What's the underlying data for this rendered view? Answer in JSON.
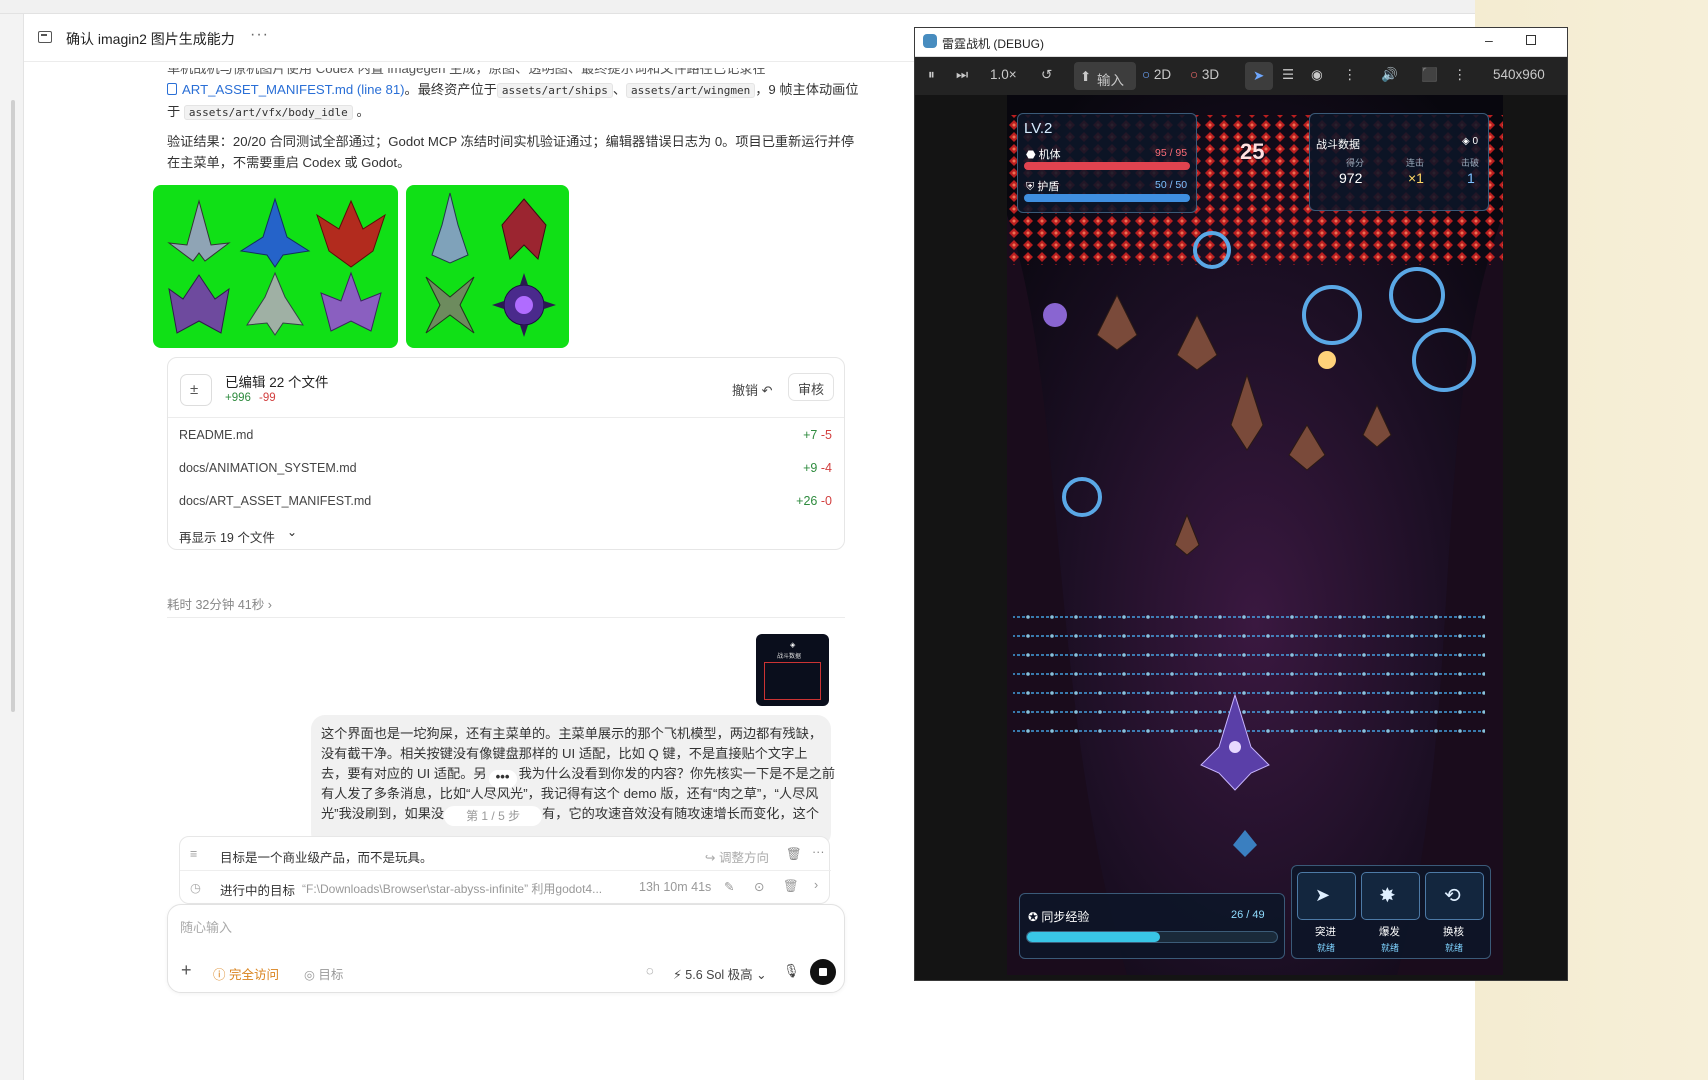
{
  "codex": {
    "chat_title": "确认 imagin2 图片生成能力",
    "more_label": "···",
    "para1_cut": "单机战机与僚机图片使用 Codex 内置 imagegen 生成，原图、透明图、最终提示词和文件路径已记录在",
    "manifest_link": "ART_ASSET_MANIFEST.md (line 81)",
    "para1_mid": "。最终资产位于",
    "path_ships": "assets/art/ships",
    "sep": "、",
    "path_wingmen": "assets/art/wingmen",
    "para1_end": "，9 帧主体动画位",
    "para1_pre": "于",
    "path_vfx": "assets/art/vfx/body_idle",
    "para1_dot": "。",
    "verify_line1": "验证结果：20/20 合同测试全部通过；Godot MCP 冻结时间实机验证通过；编辑器错误日志为 0。项目已重新运行并停",
    "verify_line2": "在主菜单，不需要重启 Codex 或 Godot。",
    "files_card": {
      "title": "已编辑 22 个文件",
      "added": "+996",
      "removed": "-99",
      "undo": "撤销",
      "review": "审核",
      "files": [
        {
          "name": "README.md",
          "added": "+7",
          "removed": "-5"
        },
        {
          "name": "docs/ANIMATION_SYSTEM.md",
          "added": "+9",
          "removed": "-4"
        },
        {
          "name": "docs/ART_ASSET_MANIFEST.md",
          "added": "+26",
          "removed": "-0"
        }
      ],
      "show_more": "再显示 19 个文件"
    },
    "elapsed": "耗时 32分钟 41秒",
    "bubble_lines": [
      "这个界面也是一坨狗屎，还有主菜单的。主菜单展示的那个飞机模型，两边都有残缺，",
      "没有截干净。相关按键没有像键盘那样的 UI 适配，比如 Q 键，不是直接贴个文字上",
      "去，要有对应的 UI 适配。另",
      "我为什么没看到你发的内容？你先核实一下是不是之前",
      "有人发了多条消息，比如“人尽风光”，我记得有这个 demo 版，还有“肉之草”，“人尽风",
      "光”我没刷到，如果没",
      "有，它的攻速音效没有随攻速增长而变化，这个"
    ],
    "step_badge": "第 1 / 5 步",
    "goal_text": "目标是一个商业级产品，而不是玩具。",
    "goal_adjust": "调整方向",
    "progress_label": "进行中的目标",
    "progress_path": "“F:\\Downloads\\Browser\\star-abyss-infinite” 利用godot4...",
    "progress_time": "13h 10m 41s",
    "input_placeholder": "随心输入",
    "full_access": "完全访问",
    "goal_btn": "目标",
    "model": "5.6 Sol 极高"
  },
  "game": {
    "window_title": "雷霆战机 (DEBUG)",
    "speed": "1.0×",
    "input_label": "输入",
    "mode_2d": "2D",
    "mode_3d": "3D",
    "resolution": "540x960",
    "level": "LV.2",
    "hull_label": "机体",
    "hull_value": "95 / 95",
    "hull_fraction": 1.0,
    "shield_label": "护盾",
    "shield_value": "50 / 50",
    "shield_fraction": 1.0,
    "wave_number": "25",
    "stats_title": "战斗数据",
    "gem_count": "0",
    "score_label": "得分",
    "combo_label": "连击",
    "kills_label": "击破",
    "score": "972",
    "combo": "×1",
    "kills": "1",
    "sync_label": "同步经验",
    "sync_value": "26 / 49",
    "sync_fraction": 0.53,
    "skills": [
      {
        "name": "突进",
        "status": "就绪"
      },
      {
        "name": "爆发",
        "status": "就绪"
      },
      {
        "name": "换核",
        "status": "就绪"
      }
    ],
    "thumb_title": "战斗数据"
  },
  "colors": {
    "accent": "#2a6fd6",
    "add": "#2e8b3e",
    "del": "#d23f3f",
    "hull": "#e0434f",
    "shield": "#3f8fe0",
    "sync": "#39c6e6"
  }
}
